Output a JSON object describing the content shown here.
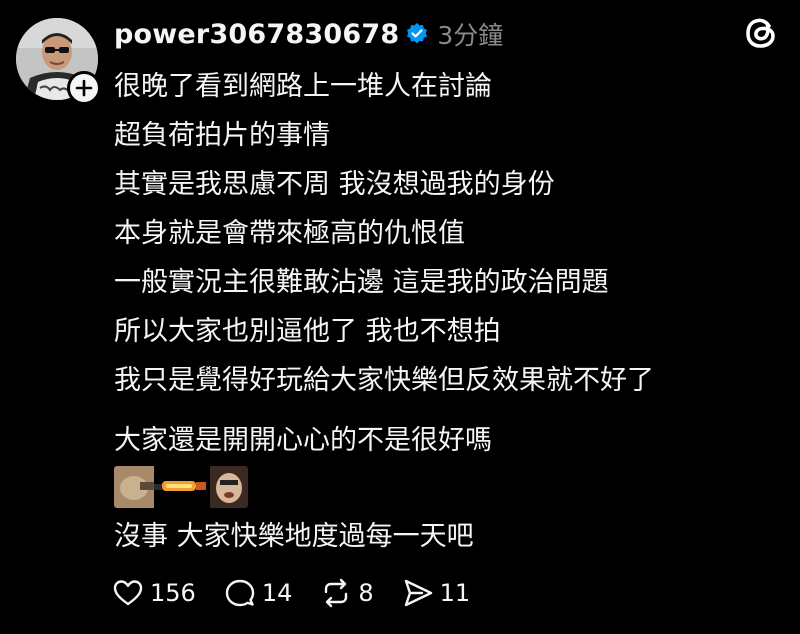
{
  "post": {
    "username": "power3067830678",
    "time": "3分鐘",
    "lines": [
      "很晚了看到網路上一堆人在討論",
      "超負荷拍片的事情",
      "其實是我思慮不周 我沒想過我的身份",
      "本身就是會帶來極高的仇恨值",
      "一般實況主很難敢沾邊 這是我的政治問題",
      "所以大家也別逼他了 我也不想拍",
      "我只是覺得好玩給大家快樂但反效果就不好了"
    ],
    "line_after_gap": "大家還是開開心心的不是很好嗎",
    "line_final": "沒事 大家快樂地度過每一天吧"
  },
  "actions": {
    "likes": "156",
    "comments": "14",
    "reposts": "8",
    "shares": "11"
  },
  "colors": {
    "background": "#000000",
    "text": "#f3f5f7",
    "muted": "#8a8a8a",
    "verified": "#0095f6"
  }
}
